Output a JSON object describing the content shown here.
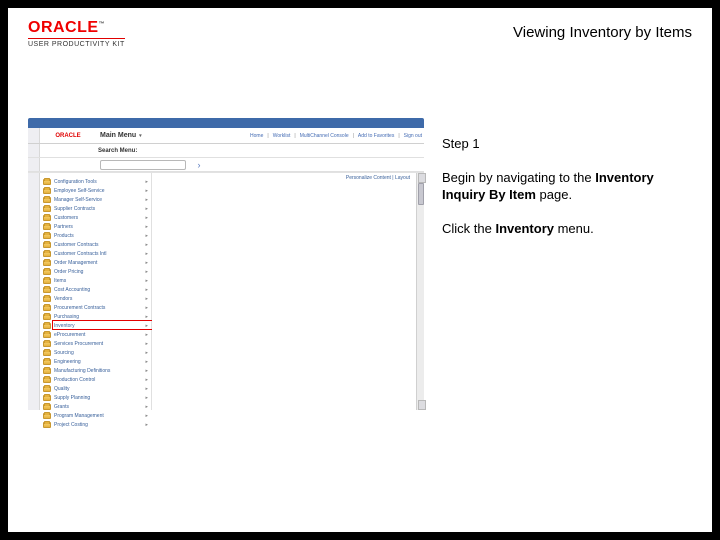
{
  "brand": {
    "oracle": "ORACLE",
    "tm": "™",
    "kit": "USER PRODUCTIVITY KIT"
  },
  "doc_title": "Viewing Inventory by Items",
  "step": {
    "label": "Step 1"
  },
  "intro": {
    "prefix": "Begin by navigating to the ",
    "page_name": "Inventory Inquiry By Item",
    "suffix": " page."
  },
  "action": {
    "prefix": "Click the ",
    "target": "Inventory",
    "suffix": " menu."
  },
  "app": {
    "brand": "ORACLE",
    "menu_bar_label": "Main Menu",
    "search_label": "Search Menu:",
    "toplinks": [
      "Home",
      "Worklist",
      "MultiChannel Console",
      "Add to Favorites",
      "Sign out"
    ],
    "personalize": "Personalize Content | Layout",
    "highlight_index": 16,
    "menu_items": [
      "Configuration Tools",
      "Employee Self-Service",
      "Manager Self-Service",
      "Supplier Contracts",
      "Customers",
      "Partners",
      "Products",
      "Customer Contracts",
      "Customer Contracts Intl",
      "Order Management",
      "Order Pricing",
      "Items",
      "Cost Accounting",
      "Vendors",
      "Procurement Contracts",
      "Purchasing",
      "Inventory",
      "eProcurement",
      "Services Procurement",
      "Sourcing",
      "Engineering",
      "Manufacturing Definitions",
      "Production Control",
      "Quality",
      "Supply Planning",
      "Grants",
      "Program Management",
      "Project Costing"
    ]
  }
}
